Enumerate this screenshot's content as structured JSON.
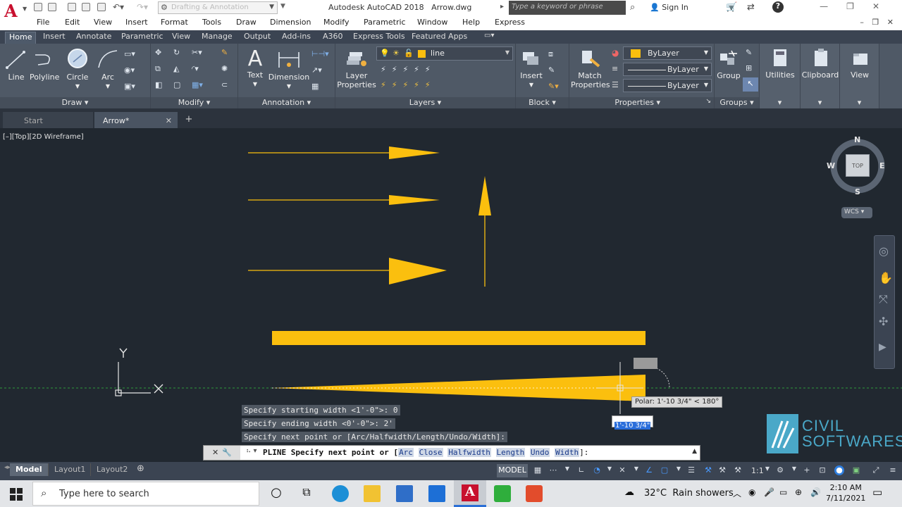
{
  "title": {
    "app": "Autodesk AutoCAD 2018",
    "file": "Arrow.dwg",
    "workspace": "Drafting & Annotation",
    "search_placeholder": "Type a keyword or phrase",
    "sign_in": "Sign In"
  },
  "menu": [
    "File",
    "Edit",
    "View",
    "Insert",
    "Format",
    "Tools",
    "Draw",
    "Dimension",
    "Modify",
    "Parametric",
    "Window",
    "Help",
    "Express"
  ],
  "ribbon_tabs": [
    "Home",
    "Insert",
    "Annotate",
    "Parametric",
    "View",
    "Manage",
    "Output",
    "Add-ins",
    "A360",
    "Express Tools",
    "Featured Apps"
  ],
  "active_ribbon_tab": "Home",
  "draw_panel": {
    "label": "Draw",
    "tools": [
      "Line",
      "Polyline",
      "Circle",
      "Arc"
    ]
  },
  "modify_panel": {
    "label": "Modify"
  },
  "annotation_panel": {
    "label": "Annotation",
    "tools": [
      "Text",
      "Dimension"
    ]
  },
  "layers_panel": {
    "label": "Layers",
    "layer_properties_line1": "Layer",
    "layer_properties_line2": "Properties",
    "current_layer": "line"
  },
  "block_panel": {
    "label": "Block",
    "insert": "Insert"
  },
  "properties_panel": {
    "label": "Properties",
    "match_line1": "Match",
    "match_line2": "Properties",
    "color": "ByLayer",
    "linetype": "ByLayer",
    "lineweight": "ByLayer"
  },
  "groups_panel": {
    "label": "Groups",
    "group": "Group"
  },
  "extras": {
    "utilities": "Utilities",
    "clipboard": "Clipboard",
    "view": "View"
  },
  "file_tabs": [
    {
      "label": "Start",
      "active": false
    },
    {
      "label": "Arrow*",
      "active": true
    }
  ],
  "viewport": {
    "label": "[–][Top][2D Wireframe]",
    "viewcube": {
      "n": "N",
      "s": "S",
      "e": "E",
      "w": "W",
      "face": "TOP",
      "wcs": "WCS"
    },
    "ucs": {
      "x": "X",
      "y": "Y"
    },
    "polar_tooltip": "Polar: 1'-10 3/4\" < 180°",
    "dynamic_input": "1'-10 3/4\"",
    "drawing_color": "#fbbf0e"
  },
  "command_history": [
    "Specify starting width <1'-0\">: 0",
    "Specify ending width <0'-0\">: 2'",
    "Specify next point or [Arc/Halfwidth/Length/Undo/Width]:"
  ],
  "command_line": {
    "prefix": "PLINE Specify next point or [",
    "options": [
      "Arc",
      "Close",
      "Halfwidth",
      "Length",
      "Undo",
      "Width"
    ],
    "suffix": "]:"
  },
  "layout_tabs": [
    {
      "label": "Model",
      "active": true
    },
    {
      "label": "Layout1",
      "active": false
    },
    {
      "label": "Layout2",
      "active": false
    }
  ],
  "status": {
    "model": "MODEL",
    "scale": "1:1"
  },
  "taskbar": {
    "search": "Type here to search",
    "weather_temp": "32°C",
    "weather_text": "Rain showers",
    "time": "2:10 AM",
    "date": "7/11/2021"
  },
  "watermark": {
    "line1": "CIVIL",
    "line2": "SOFTWARES"
  },
  "colors": {
    "accent_yellow": "#fbbf0e",
    "ribbon_bg": "#4f5966",
    "canvas_bg": "#212830"
  }
}
